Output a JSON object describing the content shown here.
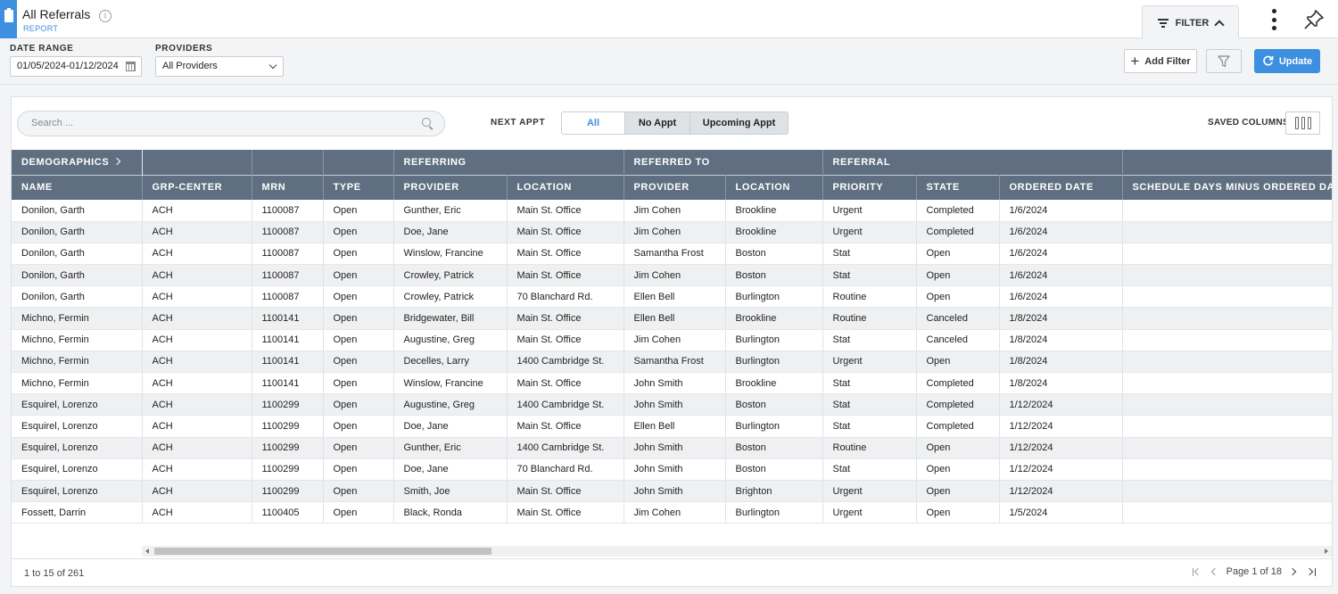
{
  "header": {
    "title": "All Referrals",
    "subtitle": "REPORT",
    "filter_label": "FILTER"
  },
  "filters": {
    "date_range_label": "DATE RANGE",
    "date_range_value": "01/05/2024-01/12/2024",
    "providers_label": "PROVIDERS",
    "providers_value": "All Providers",
    "add_filter_label": "Add Filter",
    "update_label": "Update"
  },
  "toolbar": {
    "search_placeholder": "Search ...",
    "next_appt_label": "NEXT APPT",
    "segments": [
      "All",
      "No Appt",
      "Upcoming Appt"
    ],
    "saved_columns_label": "SAVED COLUMNS"
  },
  "table": {
    "groups": [
      "DEMOGRAPHICS",
      "",
      "",
      "",
      "REFERRING",
      "REFERRED TO",
      "REFERRAL",
      ""
    ],
    "columns": [
      "NAME",
      "GRP-CENTER",
      "MRN",
      "TYPE",
      "PROVIDER",
      "LOCATION",
      "PROVIDER",
      "LOCATION",
      "PRIORITY",
      "STATE",
      "ORDERED DATE",
      "SCHEDULE DAYS MINUS ORDERED DAYS"
    ],
    "rows": [
      [
        "Donilon, Garth",
        "ACH",
        "1100087",
        "Open",
        "Gunther, Eric",
        "Main St. Office",
        "Jim Cohen",
        "Brookline",
        "Urgent",
        "Completed",
        "1/6/2024",
        ""
      ],
      [
        "Donilon, Garth",
        "ACH",
        "1100087",
        "Open",
        "Doe, Jane",
        "Main St. Office",
        "Jim Cohen",
        "Brookline",
        "Urgent",
        "Completed",
        "1/6/2024",
        ""
      ],
      [
        "Donilon, Garth",
        "ACH",
        "1100087",
        "Open",
        "Winslow, Francine",
        "Main St. Office",
        "Samantha Frost",
        "Boston",
        "Stat",
        "Open",
        "1/6/2024",
        ""
      ],
      [
        "Donilon, Garth",
        "ACH",
        "1100087",
        "Open",
        "Crowley, Patrick",
        "Main St. Office",
        "Jim Cohen",
        "Boston",
        "Stat",
        "Open",
        "1/6/2024",
        ""
      ],
      [
        "Donilon, Garth",
        "ACH",
        "1100087",
        "Open",
        "Crowley, Patrick",
        "70 Blanchard Rd.",
        "Ellen Bell",
        "Burlington",
        "Routine",
        "Open",
        "1/6/2024",
        ""
      ],
      [
        "Michno, Fermin",
        "ACH",
        "1100141",
        "Open",
        "Bridgewater, Bill",
        "Main St. Office",
        "Ellen Bell",
        "Brookline",
        "Routine",
        "Canceled",
        "1/8/2024",
        ""
      ],
      [
        "Michno, Fermin",
        "ACH",
        "1100141",
        "Open",
        "Augustine, Greg",
        "Main St. Office",
        "Jim Cohen",
        "Burlington",
        "Stat",
        "Canceled",
        "1/8/2024",
        ""
      ],
      [
        "Michno, Fermin",
        "ACH",
        "1100141",
        "Open",
        "Decelles, Larry",
        "1400 Cambridge St.",
        "Samantha Frost",
        "Burlington",
        "Urgent",
        "Open",
        "1/8/2024",
        ""
      ],
      [
        "Michno, Fermin",
        "ACH",
        "1100141",
        "Open",
        "Winslow, Francine",
        "Main St. Office",
        "John Smith",
        "Brookline",
        "Stat",
        "Completed",
        "1/8/2024",
        ""
      ],
      [
        "Esquirel, Lorenzo",
        "ACH",
        "1100299",
        "Open",
        "Augustine, Greg",
        "1400 Cambridge St.",
        "John Smith",
        "Boston",
        "Stat",
        "Completed",
        "1/12/2024",
        ""
      ],
      [
        "Esquirel, Lorenzo",
        "ACH",
        "1100299",
        "Open",
        "Doe, Jane",
        "Main St. Office",
        "Ellen Bell",
        "Burlington",
        "Stat",
        "Completed",
        "1/12/2024",
        ""
      ],
      [
        "Esquirel, Lorenzo",
        "ACH",
        "1100299",
        "Open",
        "Gunther, Eric",
        "1400 Cambridge St.",
        "John Smith",
        "Boston",
        "Routine",
        "Open",
        "1/12/2024",
        ""
      ],
      [
        "Esquirel, Lorenzo",
        "ACH",
        "1100299",
        "Open",
        "Doe, Jane",
        "70 Blanchard Rd.",
        "John Smith",
        "Boston",
        "Stat",
        "Open",
        "1/12/2024",
        ""
      ],
      [
        "Esquirel, Lorenzo",
        "ACH",
        "1100299",
        "Open",
        "Smith, Joe",
        "Main St. Office",
        "John Smith",
        "Brighton",
        "Urgent",
        "Open",
        "1/12/2024",
        ""
      ],
      [
        "Fossett, Darrin",
        "ACH",
        "1100405",
        "Open",
        "Black, Ronda",
        "Main St. Office",
        "Jim Cohen",
        "Burlington",
        "Urgent",
        "Open",
        "1/5/2024",
        ""
      ]
    ]
  },
  "footer": {
    "count_text": "1 to 15 of 261",
    "page_text": "Page 1 of 18"
  },
  "colors": {
    "accent": "#3d8fe0",
    "table_header": "#5f6f81",
    "row_alt": "#eff0f2"
  },
  "icons": {
    "report": "clipboard-icon",
    "info": "info-icon",
    "filter": "filter-lines-icon",
    "more": "kebab-icon",
    "pin": "pin-icon",
    "calendar": "calendar-icon",
    "funnel": "funnel-icon",
    "refresh": "refresh-icon",
    "search": "search-icon",
    "columns": "columns-icon"
  }
}
